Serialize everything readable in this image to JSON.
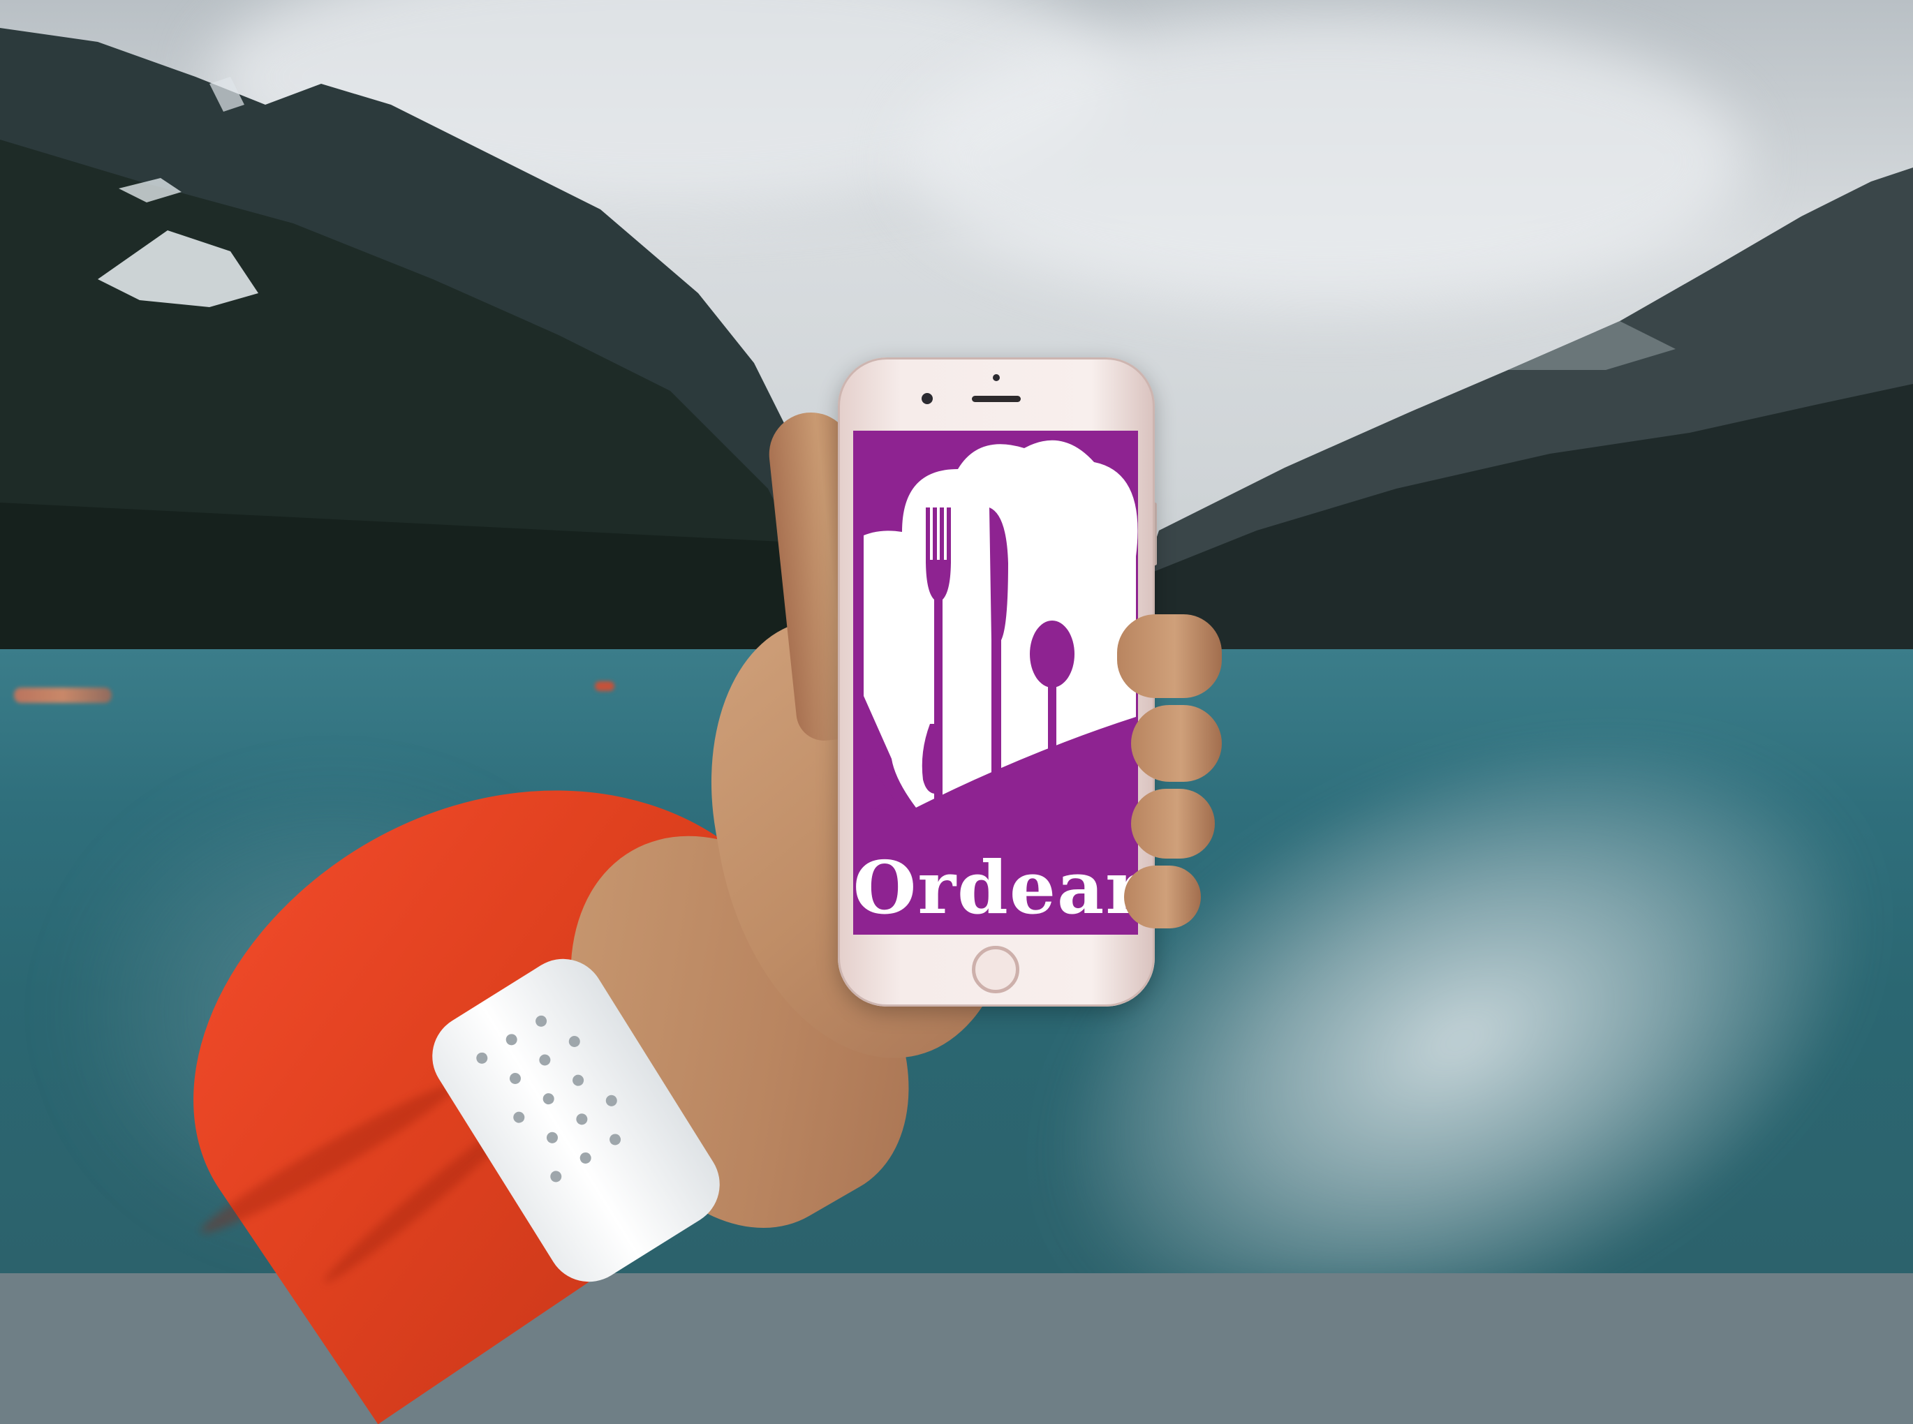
{
  "app": {
    "name": "Ordear",
    "logo_icon": "chef-hat-cutlery-icon",
    "brand_color": "#8e2391",
    "logo_color": "#ffffff"
  },
  "colors": {
    "sleeve": "#e0411f",
    "lake": "#2f6f7c",
    "sky": "#d8dcdf"
  }
}
